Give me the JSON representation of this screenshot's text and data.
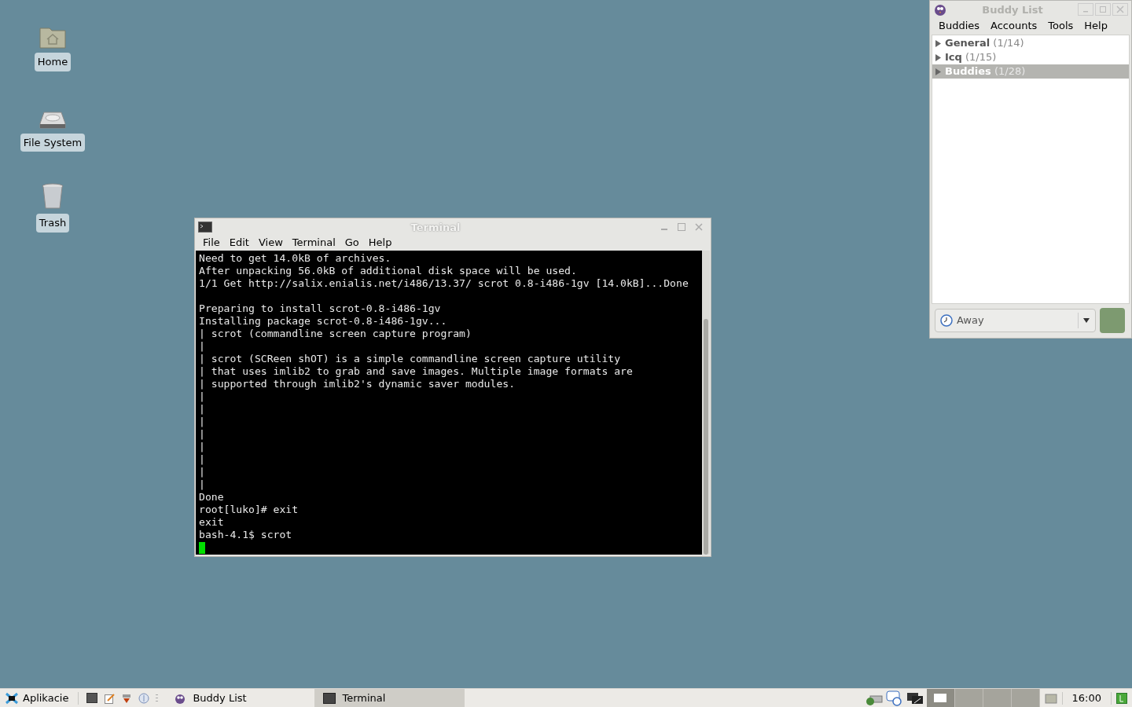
{
  "desktop_icons": [
    {
      "label": "Home",
      "kind": "home"
    },
    {
      "label": "File System",
      "kind": "drive"
    },
    {
      "label": "Trash",
      "kind": "trash"
    }
  ],
  "terminal": {
    "title": "Terminal",
    "menu": [
      "File",
      "Edit",
      "View",
      "Terminal",
      "Go",
      "Help"
    ],
    "lines": [
      {
        "kind": "text",
        "text": "Need to get 14.0kB of archives."
      },
      {
        "kind": "text",
        "text": "After unpacking 56.0kB of additional disk space will be used."
      },
      {
        "kind": "text",
        "text": "1/1 Get http://salix.enialis.net/i486/13.37/ scrot 0.8-i486-1gv [14.0kB]...Done"
      },
      {
        "kind": "blank"
      },
      {
        "kind": "text",
        "text": "Preparing to install scrot-0.8-i486-1gv"
      },
      {
        "kind": "text",
        "text": "Installing package scrot-0.8-i486-1gv..."
      },
      {
        "kind": "text",
        "text": "| scrot (commandline screen capture program)"
      },
      {
        "kind": "text",
        "text": "|"
      },
      {
        "kind": "text",
        "text": "| scrot (SCReen shOT) is a simple commandline screen capture utility"
      },
      {
        "kind": "text",
        "text": "| that uses imlib2 to grab and save images. Multiple image formats are"
      },
      {
        "kind": "text",
        "text": "| supported through imlib2's dynamic saver modules."
      },
      {
        "kind": "text",
        "text": "|"
      },
      {
        "kind": "text",
        "text": "|"
      },
      {
        "kind": "text",
        "text": "|"
      },
      {
        "kind": "text",
        "text": "|"
      },
      {
        "kind": "text",
        "text": "|"
      },
      {
        "kind": "text",
        "text": "|"
      },
      {
        "kind": "text",
        "text": "|"
      },
      {
        "kind": "text",
        "text": "|"
      },
      {
        "kind": "text",
        "text": "Done"
      },
      {
        "kind": "text",
        "text": "root[luko]# exit"
      },
      {
        "kind": "text",
        "text": "exit"
      },
      {
        "kind": "text",
        "text": "bash-4.1$ scrot"
      },
      {
        "kind": "cursor"
      }
    ]
  },
  "buddy_list": {
    "title": "Buddy List",
    "menu": [
      "Buddies",
      "Accounts",
      "Tools",
      "Help"
    ],
    "groups": [
      {
        "name": "General",
        "count": "(1/14)",
        "selected": false,
        "expanded": false
      },
      {
        "name": "Icq",
        "count": "(1/15)",
        "selected": false,
        "expanded": false
      },
      {
        "name": "Buddies",
        "count": "(1/28)",
        "selected": true,
        "expanded": false
      }
    ],
    "status": "Away"
  },
  "taskbar": {
    "start": "Aplikacie",
    "tasks": [
      {
        "label": "Buddy List",
        "kind": "pidgin",
        "selected": false
      },
      {
        "label": "Terminal",
        "kind": "terminal",
        "selected": true
      }
    ],
    "workspaces": [
      {
        "selected": true
      },
      {
        "selected": false
      },
      {
        "selected": false
      },
      {
        "selected": false
      }
    ],
    "clock": "16:00"
  }
}
